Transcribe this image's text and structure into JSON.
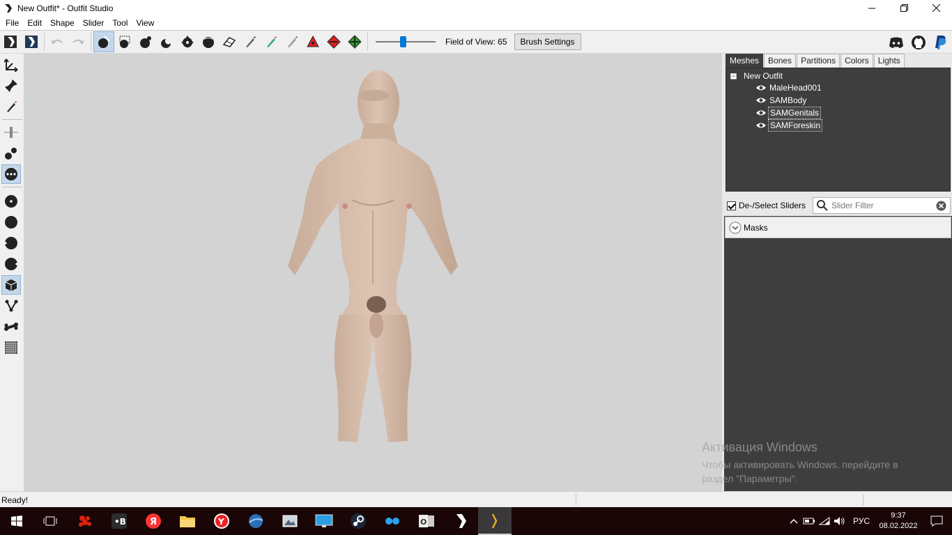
{
  "window": {
    "title": "New Outfit* - Outfit Studio",
    "icon": "outfit-studio-icon",
    "controls": [
      "minimize-icon",
      "maximize-icon",
      "close-icon"
    ]
  },
  "menu": [
    "File",
    "Edit",
    "Shape",
    "Slider",
    "Tool",
    "View"
  ],
  "toolbar": {
    "field_of_view_label": "Field of View: 65",
    "field_of_view_value": 65,
    "field_of_view_fraction": 0.45,
    "brush_settings_label": "Brush Settings",
    "tools": [
      "outfit-studio-icon",
      "bodyslide-icon",
      "undo-icon",
      "redo-icon",
      "select-brush-icon",
      "mask-brush-icon",
      "inflate-brush-icon",
      "deflate-brush-icon",
      "move-brush-icon",
      "smooth-brush-icon",
      "undiff-brush-icon",
      "weight-brush-icon",
      "color-brush-icon",
      "alpha-brush-icon",
      "collapse-vertex-icon",
      "flip-edge-icon",
      "split-edge-icon"
    ],
    "social": [
      "discord-icon",
      "github-icon",
      "paypal-icon"
    ]
  },
  "left_tools": [
    "transform-icon",
    "pivot-icon",
    "pencil-icon",
    "vertex-select-icon",
    "segment-icon",
    "points-icon",
    "dot-icon",
    "sphere-icon",
    "sphere-left-icon",
    "sphere-right-icon",
    "cube-icon",
    "bone-connect-icon",
    "bone-icon",
    "grid-icon"
  ],
  "tabs": [
    {
      "label": "Meshes",
      "active": true
    },
    {
      "label": "Bones",
      "active": false
    },
    {
      "label": "Partitions",
      "active": false
    },
    {
      "label": "Colors",
      "active": false
    },
    {
      "label": "Lights",
      "active": false
    }
  ],
  "tree": {
    "root": "New Outfit",
    "items": [
      {
        "label": "MaleHead001",
        "selected": false
      },
      {
        "label": "SAMBody",
        "selected": false
      },
      {
        "label": "SAMGenitals",
        "selected": true
      },
      {
        "label": "SAMForeskin",
        "selected": true
      }
    ]
  },
  "sliders": {
    "deselect_label": "De-/Select Sliders",
    "filter_placeholder": "Slider Filter",
    "masks_label": "Masks"
  },
  "watermark": {
    "heading": "Активация Windows",
    "text": "Чтобы активировать Windows, перейдите в раздел \"Параметры\"."
  },
  "status": {
    "text": "Ready!"
  },
  "taskbar": {
    "apps": [
      "windows-start-icon",
      "task-view-icon",
      "app-red-icon",
      "vk-icon",
      "yandex-icon",
      "file-explorer-icon",
      "yandex-browser-icon",
      "browser-globe-icon",
      "image-viewer-icon",
      "desktop-icon",
      "steam-icon",
      "app-blue-icon",
      "outlook-icon",
      "bodyslide-icon",
      "outfit-studio-icon"
    ],
    "language": "РУС",
    "time": "9:37",
    "date": "08.02.2022"
  }
}
